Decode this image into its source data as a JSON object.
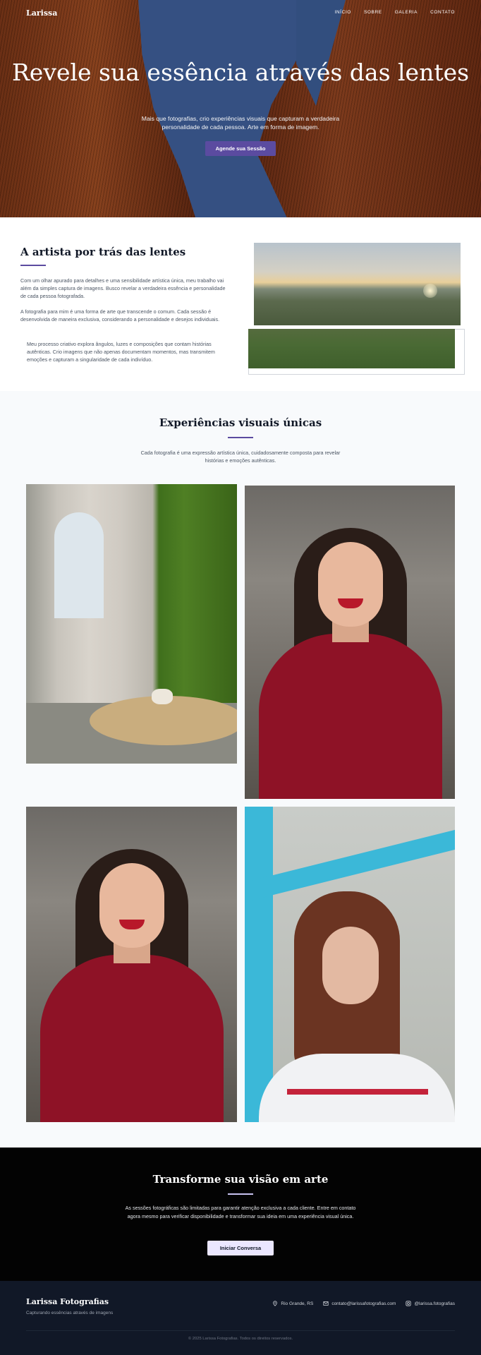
{
  "nav": {
    "logo": "Larissa",
    "items": [
      "INÍCIO",
      "SOBRE",
      "GALERIA",
      "CONTATO"
    ]
  },
  "hero": {
    "title": "Revele sua essência através das lentes",
    "subtitle": "Mais que fotografias, crio experiências visuais que capturam a verdadeira personalidade de cada pessoa. Arte em forma de imagem.",
    "button": "Agende sua Sessão"
  },
  "about": {
    "title": "A artista por trás das lentes",
    "p1": "Com um olhar apurado para detalhes e uma sensibilidade artística única, meu trabalho vai além da simples captura de imagens. Busco revelar a verdadeira essência e personalidade de cada pessoa fotografada.",
    "p2": "A fotografia para mim é uma forma de arte que transcende o comum. Cada sessão é desenvolvida de maneira exclusiva, considerando a personalidade e desejos individuais.",
    "p3": "Meu processo criativo explora ângulos, luzes e composições que contam histórias autênticas. Crio imagens que não apenas documentam momentos, mas transmitem emoções e capturam a singularidade de cada indivíduo."
  },
  "gallery": {
    "title": "Experiências visuais únicas",
    "subtitle": "Cada fotografia é uma expressão artística única, cuidadosamente composta para revelar histórias e emoções autênticas."
  },
  "cta": {
    "title": "Transforme sua visão em arte",
    "text": "As sessões fotográficas são limitadas para garantir atenção exclusiva a cada cliente. Entre em contato agora mesmo para verificar disponibilidade e transformar sua ideia em uma experiência visual única.",
    "button": "Iniciar Conversa"
  },
  "footer": {
    "brand": "Larissa Fotografias",
    "tagline": "Capturando essências através de imagens",
    "location": "Rio Grande, RS",
    "email": "contato@larissafotografias.com",
    "instagram": "@larissa.fotografias",
    "copyright": "© 2025 Larissa Fotografias. Todos os direitos reservados."
  },
  "colors": {
    "accent": "#5b4ba0",
    "cta_bg": "#030303",
    "footer_bg": "#111827"
  }
}
